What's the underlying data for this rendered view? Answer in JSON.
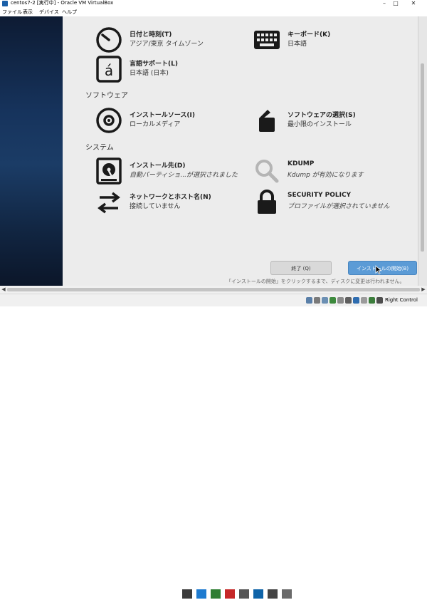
{
  "window": {
    "title": "centos7-2 [実行中] - Oracle VM VirtualBox"
  },
  "menu": {
    "items": [
      "ファイル",
      "表示",
      "デバイス",
      "ヘルプ"
    ]
  },
  "categories": {
    "software": "ソフトウェア",
    "system": "システム"
  },
  "spokes": {
    "datetime": {
      "title": "日付と時刻(T)",
      "status": "アジア/東京 タイムゾーン",
      "icon": "clock-icon"
    },
    "keyboard": {
      "title": "キーボード(K)",
      "status": "日本語",
      "icon": "keyboard-icon"
    },
    "language": {
      "title": "言語サポート(L)",
      "status": "日本語 (日本)",
      "icon": "language-icon"
    },
    "source": {
      "title": "インストールソース(I)",
      "status": "ローカルメディア",
      "icon": "disc-icon"
    },
    "software": {
      "title": "ソフトウェアの選択(S)",
      "status": "最小限のインストール",
      "icon": "package-icon"
    },
    "destination": {
      "title": "インストール先(D)",
      "status": "自動パーティショ...が選択されました",
      "icon": "harddisk-icon"
    },
    "kdump": {
      "title": "KDUMP",
      "status": "Kdump が有効になります",
      "icon": "search-icon"
    },
    "network": {
      "title": "ネットワークとホスト名(N)",
      "status": "接続していません",
      "icon": "network-arrows-icon"
    },
    "security": {
      "title": "SECURITY POLICY",
      "status": "プロファイルが選択されていません",
      "icon": "lock-icon"
    }
  },
  "buttons": {
    "quit": "終了 (Q)",
    "begin": "インストールの開始(B)"
  },
  "hint": "「インストールの開始」をクリックするまで、ディスクに変更は行われません。",
  "statusbar": {
    "host_key": "Right Control"
  },
  "colors": {
    "begin_button": "#5b9bd6",
    "sidebar": "#16335c",
    "hub_background": "#ececec"
  }
}
